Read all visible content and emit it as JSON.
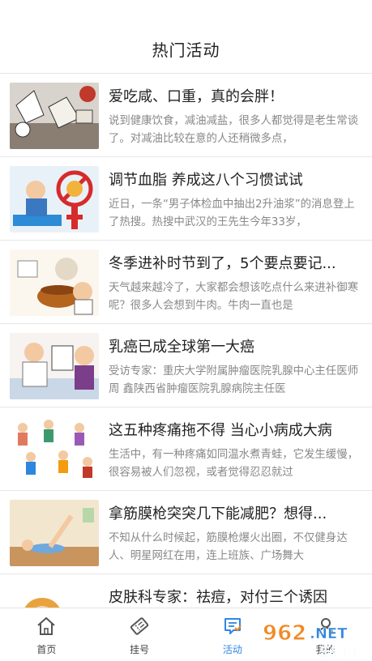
{
  "header": {
    "title": "热门活动"
  },
  "articles": [
    {
      "title": "爱吃咸、口重，真的会胖！",
      "desc": "说到健康饮食，减油减盐，很多人都觉得是老生常谈了。对减油比较在意的人还稍微多点，",
      "thumb_icon": "salt-food-illustration"
    },
    {
      "title": "调节血脂 养成这八个习惯试试",
      "desc": "近日，一条“男子体检血中抽出2升油浆”的消息登上了热搜。热搜中武汉的王先生今年33岁，",
      "thumb_icon": "blood-lipid-illustration"
    },
    {
      "title": "冬季进补时节到了，5个要点要记...",
      "desc": "天气越来越冷了，大家都会想该吃点什么来进补御寒呢？很多人会想到牛肉。牛肉一直也是",
      "thumb_icon": "winter-tonic-illustration"
    },
    {
      "title": "乳癌已成全球第一大癌",
      "desc": "受访专家：重庆大学附属肿瘤医院乳腺中心主任医师 周 鑫陕西省肿瘤医院乳腺病院主任医",
      "thumb_icon": "doctor-consult-illustration"
    },
    {
      "title": "这五种疼痛拖不得 当心小病成大病",
      "desc": "生活中，有一种疼痛如同温水煮青蛙，它发生缓慢，很容易被人们忽视，或者觉得忍忍就过",
      "thumb_icon": "pain-people-illustration"
    },
    {
      "title": "拿筋膜枪突突几下能减肥？想得...",
      "desc": "不知从什么时候起，筋膜枪爆火出圈，不仅健身达人、明星网红在用，连上班族、广场舞大",
      "thumb_icon": "stretching-illustration"
    },
    {
      "title": "皮肤科专家：祛痘，对付三个诱因",
      "desc": "",
      "thumb_icon": "skin-care-illustration"
    }
  ],
  "tabs": [
    {
      "label": "首页",
      "icon": "home-icon",
      "active": false
    },
    {
      "label": "挂号",
      "icon": "ticket-icon",
      "active": false
    },
    {
      "label": "活动",
      "icon": "activity-icon",
      "active": true
    },
    {
      "label": "我的",
      "icon": "user-icon",
      "active": false
    }
  ],
  "watermark": {
    "line1": "962.NET",
    "line2": "乐游网"
  },
  "colors": {
    "accent": "#2f86e0",
    "divider": "#e6e6e6",
    "title": "#222222",
    "desc": "#888888"
  }
}
